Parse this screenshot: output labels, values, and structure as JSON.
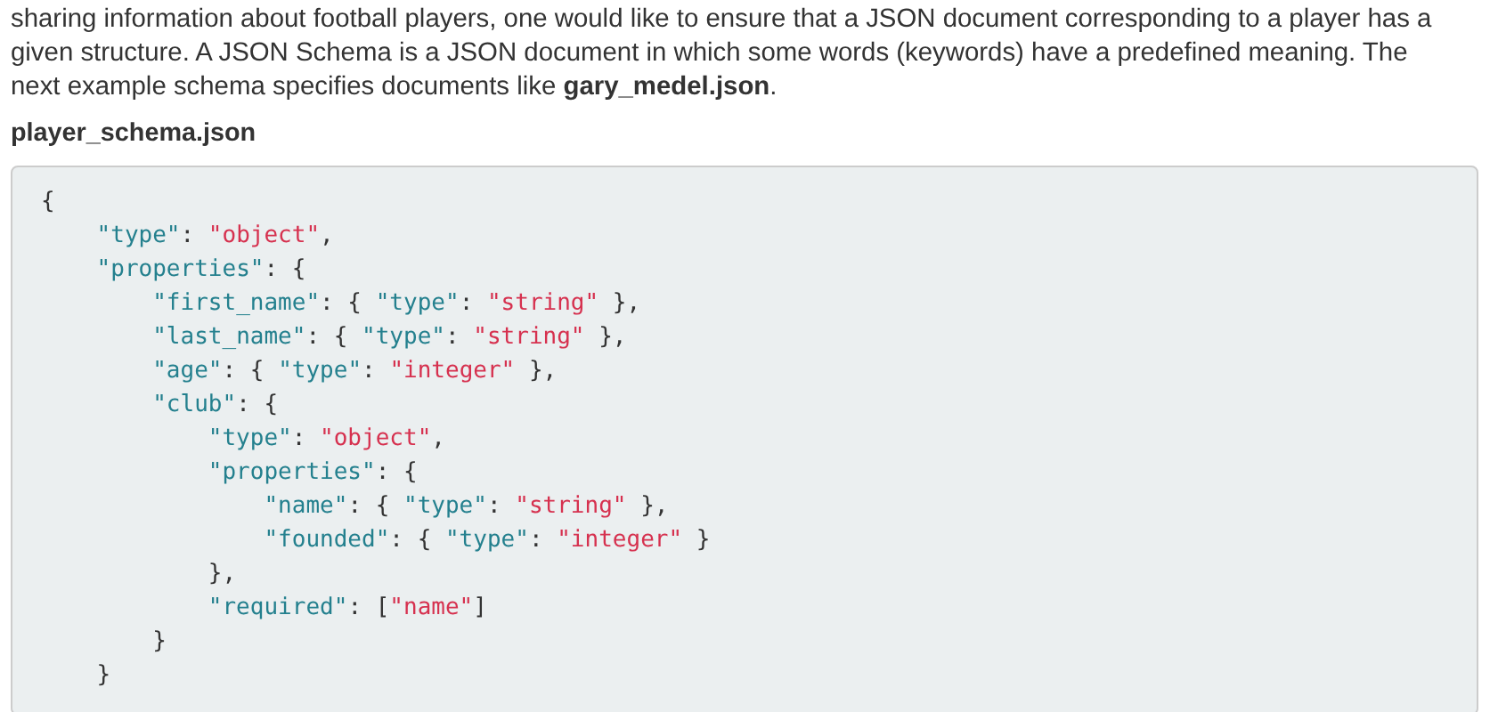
{
  "paragraph": "sharing information about football players, one would like to ensure that a JSON document corresponding to a player has a given structure. A JSON Schema is a JSON document in which some words (keywords) have a predefined meaning. The next example schema specifies documents like **gary_medel.json**.",
  "file_name": "player_schema.json",
  "code": [
    {
      "tokens": [
        {
          "kind": "punct",
          "text": "{"
        }
      ],
      "children": [
        {
          "tokens": [
            {
              "kind": "key",
              "text": "\"type\""
            },
            {
              "kind": "punct",
              "text": ": "
            },
            {
              "kind": "string",
              "text": "\"object\""
            },
            {
              "kind": "punct",
              "text": ","
            }
          ]
        },
        {
          "tokens": [
            {
              "kind": "key",
              "text": "\"properties\""
            },
            {
              "kind": "punct",
              "text": ": {"
            }
          ],
          "children": [
            {
              "tokens": [
                {
                  "kind": "key",
                  "text": "\"first_name\""
                },
                {
                  "kind": "punct",
                  "text": ": { "
                },
                {
                  "kind": "key",
                  "text": "\"type\""
                },
                {
                  "kind": "punct",
                  "text": ": "
                },
                {
                  "kind": "string",
                  "text": "\"string\""
                },
                {
                  "kind": "punct",
                  "text": " },"
                }
              ]
            },
            {
              "tokens": [
                {
                  "kind": "key",
                  "text": "\"last_name\""
                },
                {
                  "kind": "punct",
                  "text": ": { "
                },
                {
                  "kind": "key",
                  "text": "\"type\""
                },
                {
                  "kind": "punct",
                  "text": ": "
                },
                {
                  "kind": "string",
                  "text": "\"string\""
                },
                {
                  "kind": "punct",
                  "text": " },"
                }
              ]
            },
            {
              "tokens": [
                {
                  "kind": "key",
                  "text": "\"age\""
                },
                {
                  "kind": "punct",
                  "text": ": { "
                },
                {
                  "kind": "key",
                  "text": "\"type\""
                },
                {
                  "kind": "punct",
                  "text": ": "
                },
                {
                  "kind": "string",
                  "text": "\"integer\""
                },
                {
                  "kind": "punct",
                  "text": " },"
                }
              ]
            },
            {
              "tokens": [
                {
                  "kind": "key",
                  "text": "\"club\""
                },
                {
                  "kind": "punct",
                  "text": ": {"
                }
              ],
              "children": [
                {
                  "tokens": [
                    {
                      "kind": "key",
                      "text": "\"type\""
                    },
                    {
                      "kind": "punct",
                      "text": ": "
                    },
                    {
                      "kind": "string",
                      "text": "\"object\""
                    },
                    {
                      "kind": "punct",
                      "text": ","
                    }
                  ]
                },
                {
                  "tokens": [
                    {
                      "kind": "key",
                      "text": "\"properties\""
                    },
                    {
                      "kind": "punct",
                      "text": ": {"
                    }
                  ],
                  "children": [
                    {
                      "tokens": [
                        {
                          "kind": "key",
                          "text": "\"name\""
                        },
                        {
                          "kind": "punct",
                          "text": ": { "
                        },
                        {
                          "kind": "key",
                          "text": "\"type\""
                        },
                        {
                          "kind": "punct",
                          "text": ": "
                        },
                        {
                          "kind": "string",
                          "text": "\"string\""
                        },
                        {
                          "kind": "punct",
                          "text": " },"
                        }
                      ]
                    },
                    {
                      "tokens": [
                        {
                          "kind": "key",
                          "text": "\"founded\""
                        },
                        {
                          "kind": "punct",
                          "text": ": { "
                        },
                        {
                          "kind": "key",
                          "text": "\"type\""
                        },
                        {
                          "kind": "punct",
                          "text": ": "
                        },
                        {
                          "kind": "string",
                          "text": "\"integer\""
                        },
                        {
                          "kind": "punct",
                          "text": " }"
                        }
                      ]
                    }
                  ]
                },
                {
                  "tokens": [
                    {
                      "kind": "punct",
                      "text": "},"
                    }
                  ]
                },
                {
                  "tokens": [
                    {
                      "kind": "key",
                      "text": "\"required\""
                    },
                    {
                      "kind": "punct",
                      "text": ": ["
                    },
                    {
                      "kind": "string",
                      "text": "\"name\""
                    },
                    {
                      "kind": "punct",
                      "text": "]"
                    }
                  ]
                }
              ]
            },
            {
              "tokens": [
                {
                  "kind": "punct",
                  "text": "}"
                }
              ]
            }
          ]
        },
        {
          "tokens": [
            {
              "kind": "punct",
              "text": "}"
            }
          ]
        }
      ]
    }
  ]
}
